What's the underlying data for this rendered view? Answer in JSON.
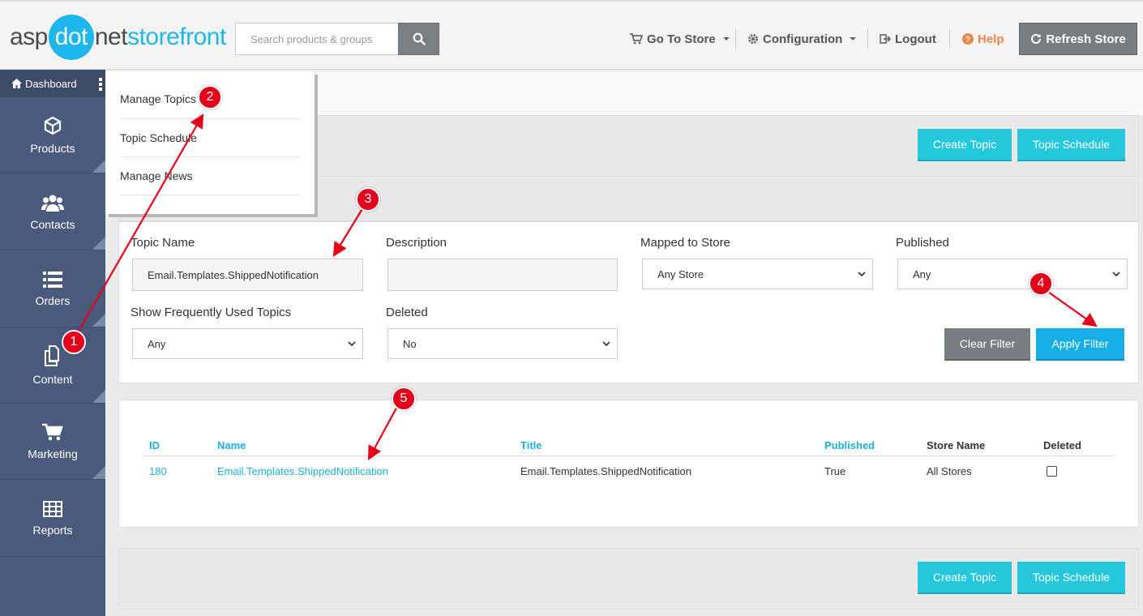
{
  "header": {
    "logo": {
      "part1": "asp",
      "part2": "dot",
      "part3": "net",
      "part4": "storefront"
    },
    "search_placeholder": "Search products & groups",
    "nav": {
      "go_to_store": "Go To Store",
      "configuration": "Configuration",
      "logout": "Logout",
      "help": "Help"
    },
    "refresh": "Refresh Store"
  },
  "sidebar": {
    "dashboard": "Dashboard",
    "items": [
      {
        "label": "Products",
        "icon": "cube-icon"
      },
      {
        "label": "Contacts",
        "icon": "users-icon"
      },
      {
        "label": "Orders",
        "icon": "list-icon"
      },
      {
        "label": "Content",
        "icon": "copy-icon"
      },
      {
        "label": "Marketing",
        "icon": "cart-icon"
      },
      {
        "label": "Reports",
        "icon": "table-icon"
      }
    ]
  },
  "dropdown": {
    "items": [
      {
        "label": "Manage Topics"
      },
      {
        "label": "Topic Schedule"
      },
      {
        "label": "Manage News"
      }
    ]
  },
  "actions": {
    "create_topic": "Create Topic",
    "topic_schedule": "Topic Schedule"
  },
  "filter": {
    "topic_name_label": "Topic Name",
    "topic_name_value": "Email.Templates.ShippedNotification",
    "description_label": "Description",
    "description_value": "",
    "mapped_label": "Mapped to Store",
    "mapped_value": "Any Store",
    "published_label": "Published",
    "published_value": "Any",
    "frequent_label": "Show Frequently Used Topics",
    "frequent_value": "Any",
    "deleted_label": "Deleted",
    "deleted_value": "No",
    "clear": "Clear Filter",
    "apply": "Apply Filter"
  },
  "table": {
    "headers": {
      "id": "ID",
      "name": "Name",
      "title": "Title",
      "published": "Published",
      "store": "Store Name",
      "deleted": "Deleted"
    },
    "rows": [
      {
        "id": "180",
        "name": "Email.Templates.ShippedNotification",
        "title": "Email.Templates.ShippedNotification",
        "published": "True",
        "store": "All Stores",
        "deleted": false
      }
    ]
  },
  "annotations": [
    "1",
    "2",
    "3",
    "4",
    "5"
  ],
  "colors": {
    "accent": "#1db7ee",
    "teal": "#25c7dc",
    "sidebar": "#4a5a7c",
    "badge": "#e3001b"
  }
}
